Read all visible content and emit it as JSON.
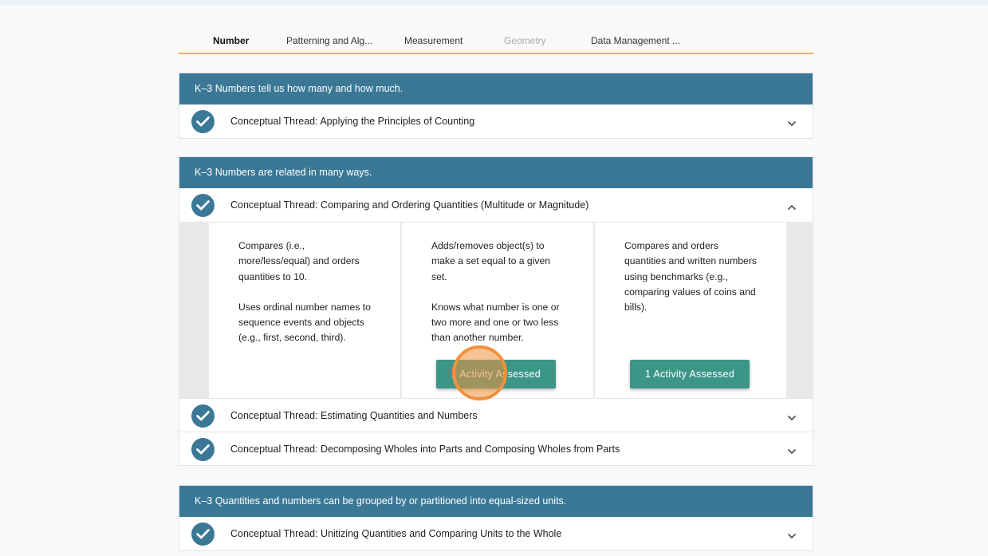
{
  "tabs": [
    {
      "label": "Number",
      "state": "active"
    },
    {
      "label": "Patterning and Alg...",
      "state": "normal"
    },
    {
      "label": "Measurement",
      "state": "normal"
    },
    {
      "label": "Geometry",
      "state": "disabled"
    },
    {
      "label": "Data Management ...",
      "state": "normal"
    }
  ],
  "sections": [
    {
      "title": "K–3 Numbers tell us how many and how much.",
      "threads": [
        {
          "label": "Conceptual Thread: Applying the Principles of Counting",
          "expanded": false
        }
      ]
    },
    {
      "title": "K–3 Numbers are related in many ways.",
      "threads": [
        {
          "label": "Conceptual Thread: Comparing and Ordering Quantities (Multitude or Magnitude)",
          "expanded": true,
          "cards": [
            {
              "paragraphs": [
                "Compares (i.e., more/less/equal) and orders quantities to 10.",
                "Uses ordinal number names to sequence events and objects (e.g., first, second, third)."
              ],
              "button": null
            },
            {
              "paragraphs": [
                "Adds/removes object(s) to make a set equal to a given set.",
                "Knows what number is one or two more and one or two less than another number."
              ],
              "button": "1 Activity Assessed"
            },
            {
              "paragraphs": [
                "Compares and orders quantities and written numbers using benchmarks (e.g., comparing values of coins and bills)."
              ],
              "button": "1 Activity Assessed"
            }
          ]
        },
        {
          "label": "Conceptual Thread: Estimating Quantities and Numbers",
          "expanded": false
        },
        {
          "label": "Conceptual Thread: Decomposing Wholes into Parts and Composing Wholes from Parts",
          "expanded": false
        }
      ]
    },
    {
      "title": "K–3 Quantities and numbers can be grouped by or partitioned into equal-sized units.",
      "threads": [
        {
          "label": "Conceptual Thread: Unitizing Quantities and Comparing Units to the Whole",
          "expanded": false
        }
      ]
    }
  ],
  "colors": {
    "header_blue": "#3a7896",
    "tab_underline": "#f0b24e",
    "button_teal": "#3c9688",
    "click_indicator": "#f0913c"
  },
  "icons": {
    "check": "check-circle-icon",
    "expand": "chevron-down-icon",
    "collapse": "chevron-up-icon"
  }
}
